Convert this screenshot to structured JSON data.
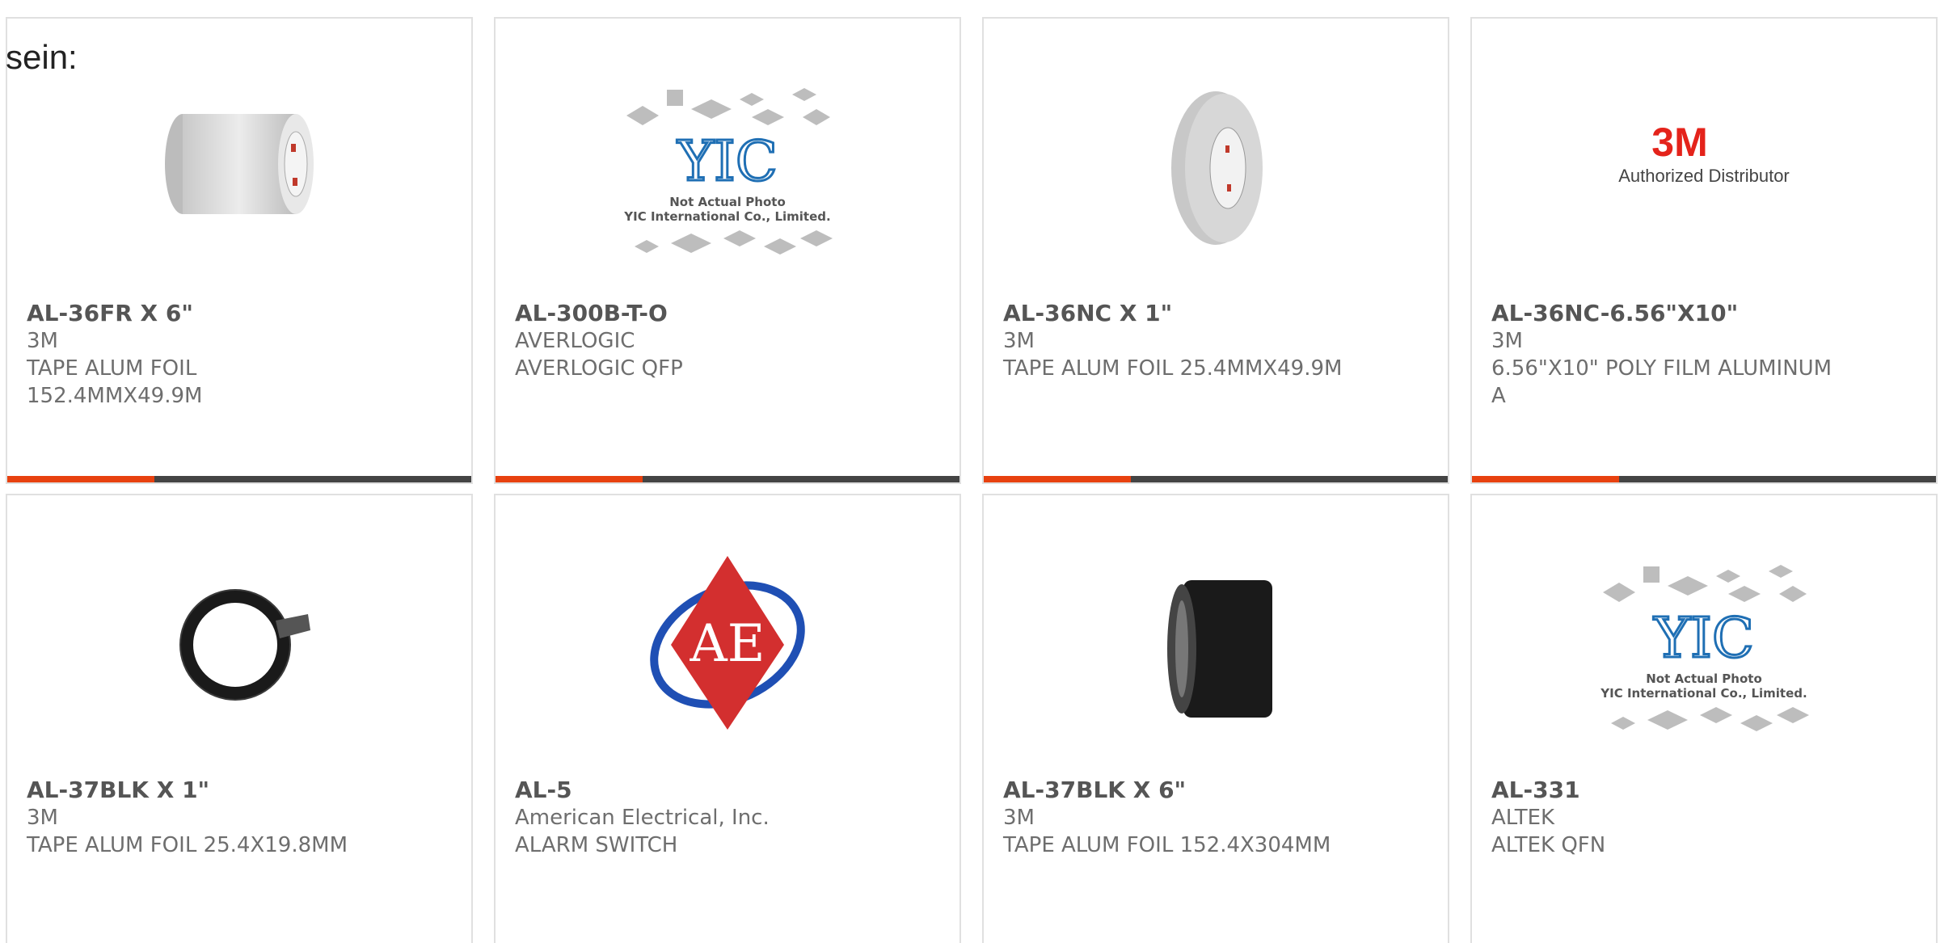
{
  "leading_text": "sein:",
  "colors": {
    "accent": "#e8410f",
    "bar": "#444444",
    "border": "#e0e0e0"
  },
  "products": [
    {
      "part": "AL-36FR X 6\"",
      "maker": "3M",
      "desc": "TAPE ALUM FOIL 152.4MMX49.9M",
      "image": "foil-roll-wide"
    },
    {
      "part": "AL-300B-T-O",
      "maker": "AVERLOGIC",
      "desc": "AVERLOGIC QFP",
      "image": "yic-placeholder",
      "image_text": {
        "logo": "YIC",
        "line1": "Not Actual Photo",
        "line2": "YIC International Co., Limited."
      }
    },
    {
      "part": "AL-36NC X 1\"",
      "maker": "3M",
      "desc": "TAPE ALUM FOIL 25.4MMX49.9M",
      "image": "foil-roll-narrow"
    },
    {
      "part": "AL-36NC-6.56\"X10\"",
      "maker": "3M",
      "desc": "6.56\"X10\" POLY FILM ALUMINUM A",
      "image": "3m-authorized",
      "image_text": {
        "logo": "3M",
        "line1": "Authorized Distributor"
      }
    },
    {
      "part": "AL-37BLK X 1\"",
      "maker": "3M",
      "desc": "TAPE ALUM FOIL 25.4X19.8MM",
      "image": "black-tape-ring"
    },
    {
      "part": "AL-5",
      "maker": "American Electrical, Inc.",
      "desc": "ALARM SWITCH",
      "image": "ae-logo",
      "image_text": {
        "logo": "AE"
      }
    },
    {
      "part": "AL-37BLK X 6\"",
      "maker": "3M",
      "desc": "TAPE ALUM FOIL 152.4X304MM",
      "image": "black-tape-wide"
    },
    {
      "part": "AL-331",
      "maker": "ALTEK",
      "desc": "ALTEK QFN",
      "image": "yic-placeholder",
      "image_text": {
        "logo": "YIC",
        "line1": "Not Actual Photo",
        "line2": "YIC International Co., Limited."
      }
    }
  ]
}
